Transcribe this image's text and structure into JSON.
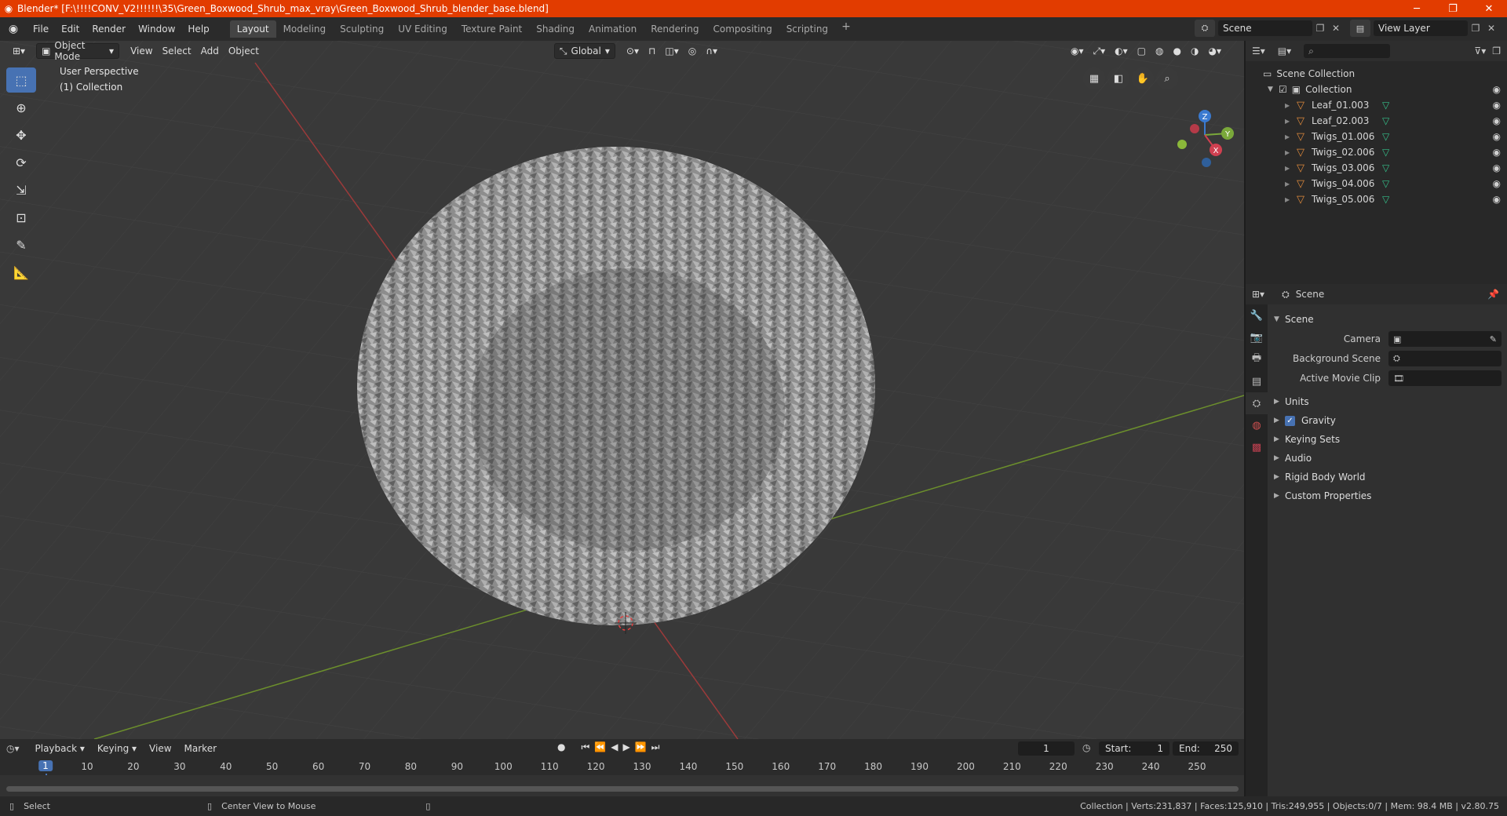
{
  "titlebar": {
    "title": "Blender* [F:\\!!!!CONV_V2!!!!!!\\35\\Green_Boxwood_Shrub_max_vray\\Green_Boxwood_Shrub_blender_base.blend]",
    "minimize": "─",
    "restore": "❐",
    "close": "✕"
  },
  "menu": [
    "File",
    "Edit",
    "Render",
    "Window",
    "Help"
  ],
  "workspaces": [
    {
      "label": "Layout",
      "active": true
    },
    {
      "label": "Modeling",
      "active": false
    },
    {
      "label": "Sculpting",
      "active": false
    },
    {
      "label": "UV Editing",
      "active": false
    },
    {
      "label": "Texture Paint",
      "active": false
    },
    {
      "label": "Shading",
      "active": false
    },
    {
      "label": "Animation",
      "active": false
    },
    {
      "label": "Rendering",
      "active": false
    },
    {
      "label": "Compositing",
      "active": false
    },
    {
      "label": "Scripting",
      "active": false
    }
  ],
  "scene_selector": {
    "value": "Scene"
  },
  "view_layer_selector": {
    "value": "View Layer"
  },
  "viewport": {
    "mode": "Object Mode",
    "menus": [
      "View",
      "Select",
      "Add",
      "Object"
    ],
    "orientation": "Global",
    "perspective_label": "User Perspective",
    "collection_label": "(1) Collection",
    "gizmo": {
      "x": "X",
      "y": "Y",
      "z": "Z"
    },
    "colors": {
      "grid_x_axis": "#b23a3a",
      "grid_y_axis": "#6f9a2a",
      "bg": "#3a3a3a",
      "accent": "#4772b3"
    }
  },
  "outliner": {
    "root": "Scene Collection",
    "collection": "Collection",
    "objects": [
      "Leaf_01.003",
      "Leaf_02.003",
      "Twigs_01.006",
      "Twigs_02.006",
      "Twigs_03.006",
      "Twigs_04.006",
      "Twigs_05.006"
    ]
  },
  "properties": {
    "context": "Scene",
    "section": "Scene",
    "fields": [
      {
        "label": "Camera",
        "value": ""
      },
      {
        "label": "Background Scene",
        "value": ""
      },
      {
        "label": "Active Movie Clip",
        "value": ""
      }
    ],
    "panels": [
      {
        "label": "Units",
        "checkbox": false
      },
      {
        "label": "Gravity",
        "checkbox": true
      },
      {
        "label": "Keying Sets",
        "checkbox": false
      },
      {
        "label": "Audio",
        "checkbox": false
      },
      {
        "label": "Rigid Body World",
        "checkbox": false
      },
      {
        "label": "Custom Properties",
        "checkbox": false
      }
    ]
  },
  "timeline": {
    "menus": [
      "Playback",
      "Keying",
      "View",
      "Marker"
    ],
    "current_frame": "1",
    "start_label": "Start:",
    "start": "1",
    "end_label": "End:",
    "end": "250",
    "ticks": [
      "1",
      "10",
      "20",
      "30",
      "40",
      "50",
      "60",
      "70",
      "80",
      "90",
      "100",
      "110",
      "120",
      "130",
      "140",
      "150",
      "160",
      "170",
      "180",
      "190",
      "200",
      "210",
      "220",
      "230",
      "240",
      "250"
    ]
  },
  "statusbar": {
    "left_hint": "Select",
    "mid_hint": "Center View to Mouse",
    "stats": "Collection | Verts:231,837 | Faces:125,910 | Tris:249,955 | Objects:0/7 | Mem: 98.4 MB | v2.80.75"
  }
}
